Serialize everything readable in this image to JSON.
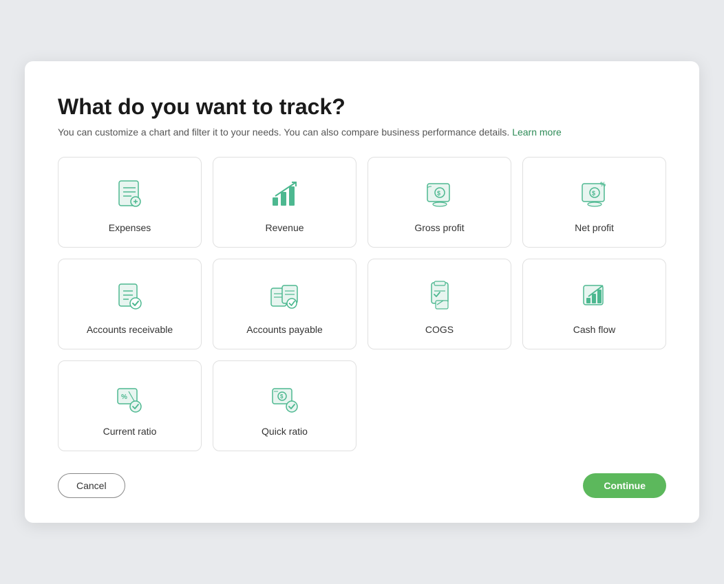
{
  "modal": {
    "title": "What do you want to track?",
    "subtitle": "You can customize a chart and filter it to your needs. You can also compare business performance details.",
    "learn_more": "Learn more"
  },
  "cards": [
    {
      "id": "expenses",
      "label": "Expenses",
      "icon": "expenses"
    },
    {
      "id": "revenue",
      "label": "Revenue",
      "icon": "revenue"
    },
    {
      "id": "gross-profit",
      "label": "Gross profit",
      "icon": "gross-profit"
    },
    {
      "id": "net-profit",
      "label": "Net profit",
      "icon": "net-profit"
    },
    {
      "id": "accounts-receivable",
      "label": "Accounts receivable",
      "icon": "accounts-receivable"
    },
    {
      "id": "accounts-payable",
      "label": "Accounts payable",
      "icon": "accounts-payable"
    },
    {
      "id": "cogs",
      "label": "COGS",
      "icon": "cogs"
    },
    {
      "id": "cash-flow",
      "label": "Cash flow",
      "icon": "cash-flow"
    },
    {
      "id": "current-ratio",
      "label": "Current ratio",
      "icon": "current-ratio"
    },
    {
      "id": "quick-ratio",
      "label": "Quick ratio",
      "icon": "quick-ratio"
    }
  ],
  "footer": {
    "cancel_label": "Cancel",
    "continue_label": "Continue"
  }
}
